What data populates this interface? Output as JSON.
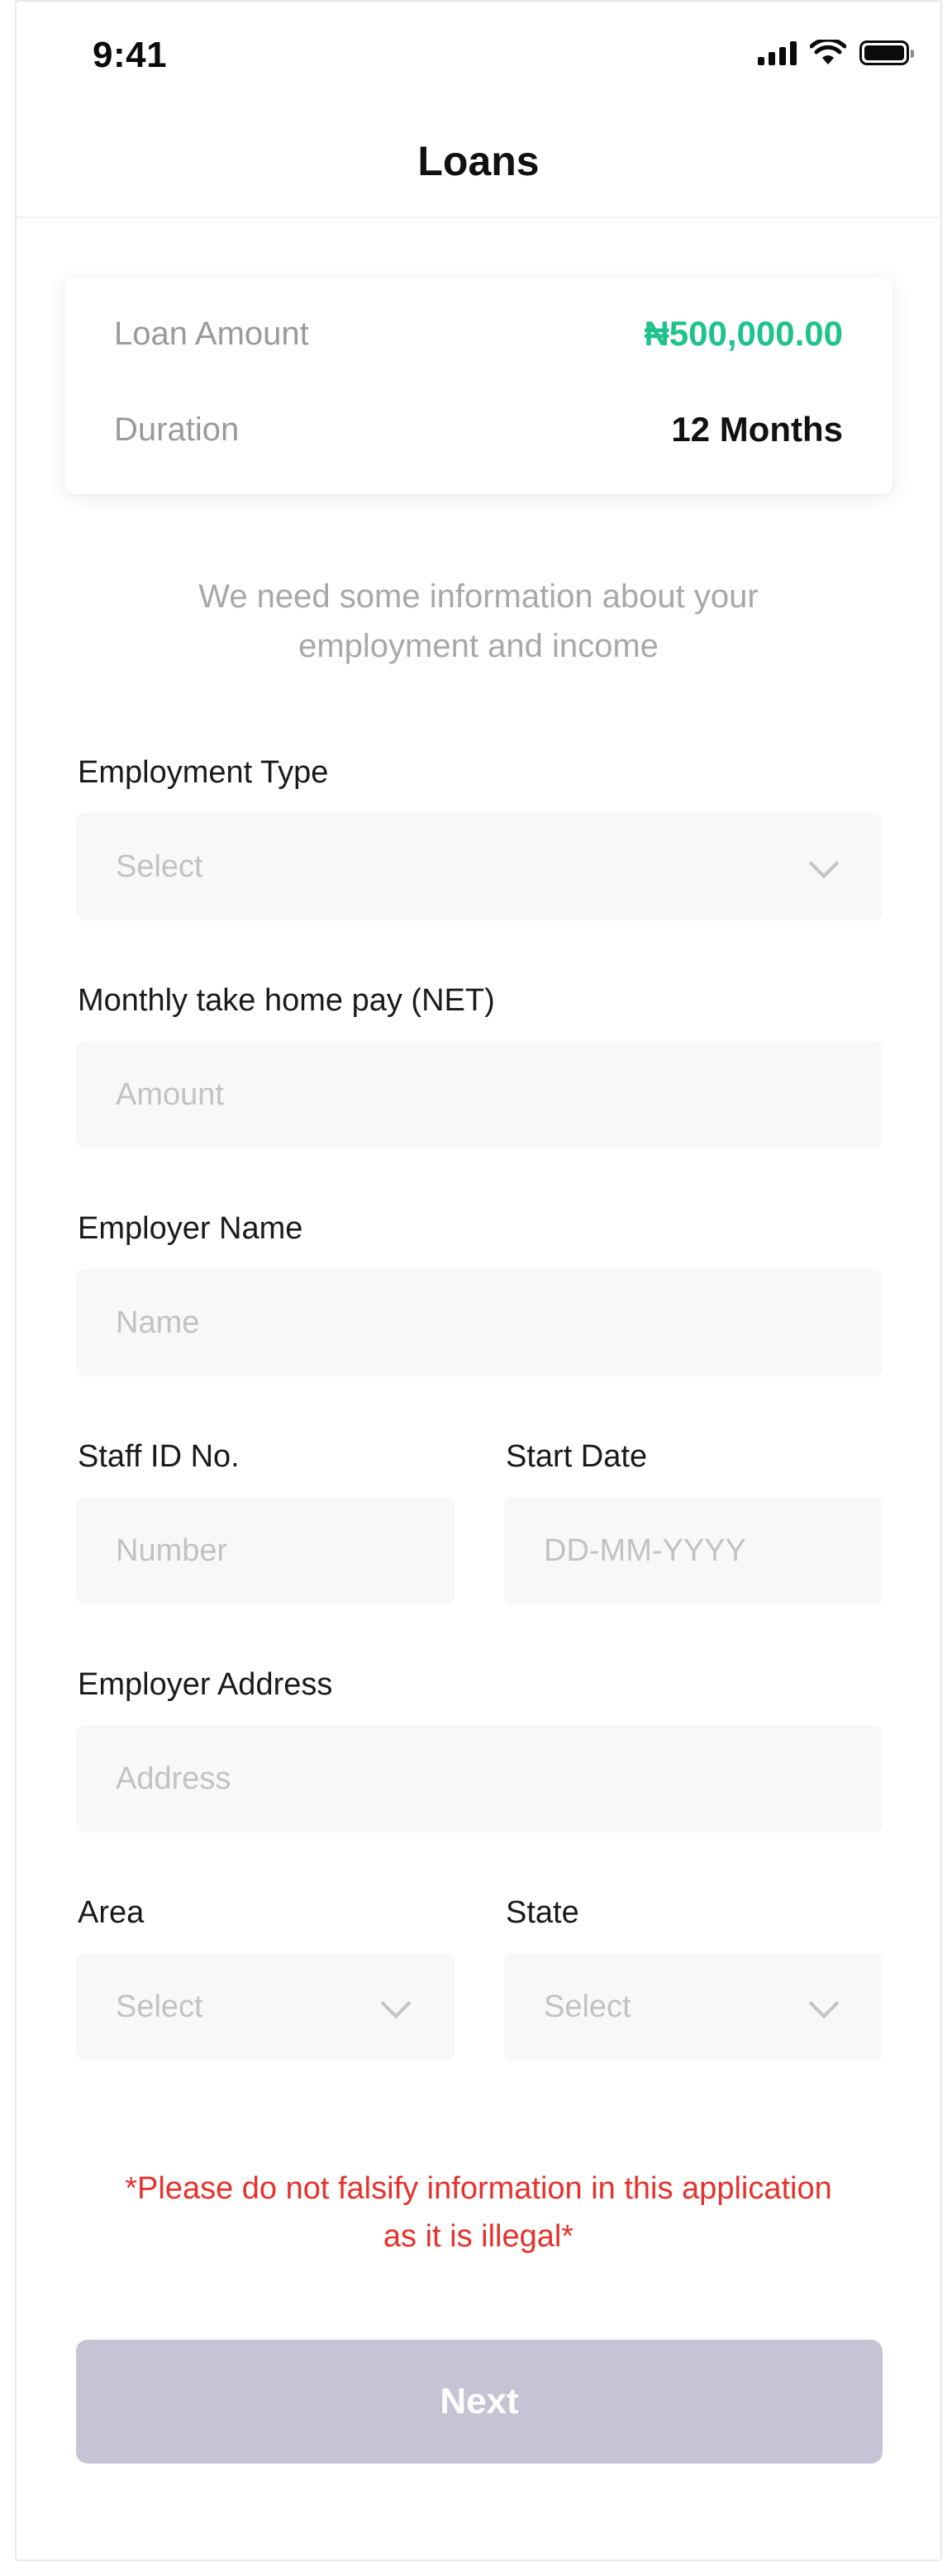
{
  "status_bar": {
    "time": "9:41",
    "icons": [
      "signal-icon",
      "wifi-icon",
      "battery-icon"
    ]
  },
  "header": {
    "title": "Loans"
  },
  "summary": {
    "loan_amount_label": "Loan Amount",
    "loan_amount_value": "₦500,000.00",
    "duration_label": "Duration",
    "duration_value": "12 Months"
  },
  "intro_text": "We need some information about your employment and income",
  "form": {
    "employment_type": {
      "label": "Employment Type",
      "placeholder": "Select"
    },
    "monthly_pay": {
      "label": "Monthly take home pay (NET)",
      "placeholder": "Amount"
    },
    "employer_name": {
      "label": "Employer Name",
      "placeholder": "Name"
    },
    "staff_id": {
      "label": "Staff ID No.",
      "placeholder": "Number"
    },
    "start_date": {
      "label": "Start Date",
      "placeholder": "DD-MM-YYYY"
    },
    "employer_address": {
      "label": "Employer Address",
      "placeholder": "Address"
    },
    "area": {
      "label": "Area",
      "placeholder": "Select"
    },
    "state": {
      "label": "State",
      "placeholder": "Select"
    }
  },
  "warning": "*Please do not falsify information in this application as it is illegal*",
  "next_button": "Next",
  "colors": {
    "accent_green": "#1ec28b",
    "warning_red": "#e5322d",
    "button_disabled": "#c7c3d4"
  }
}
